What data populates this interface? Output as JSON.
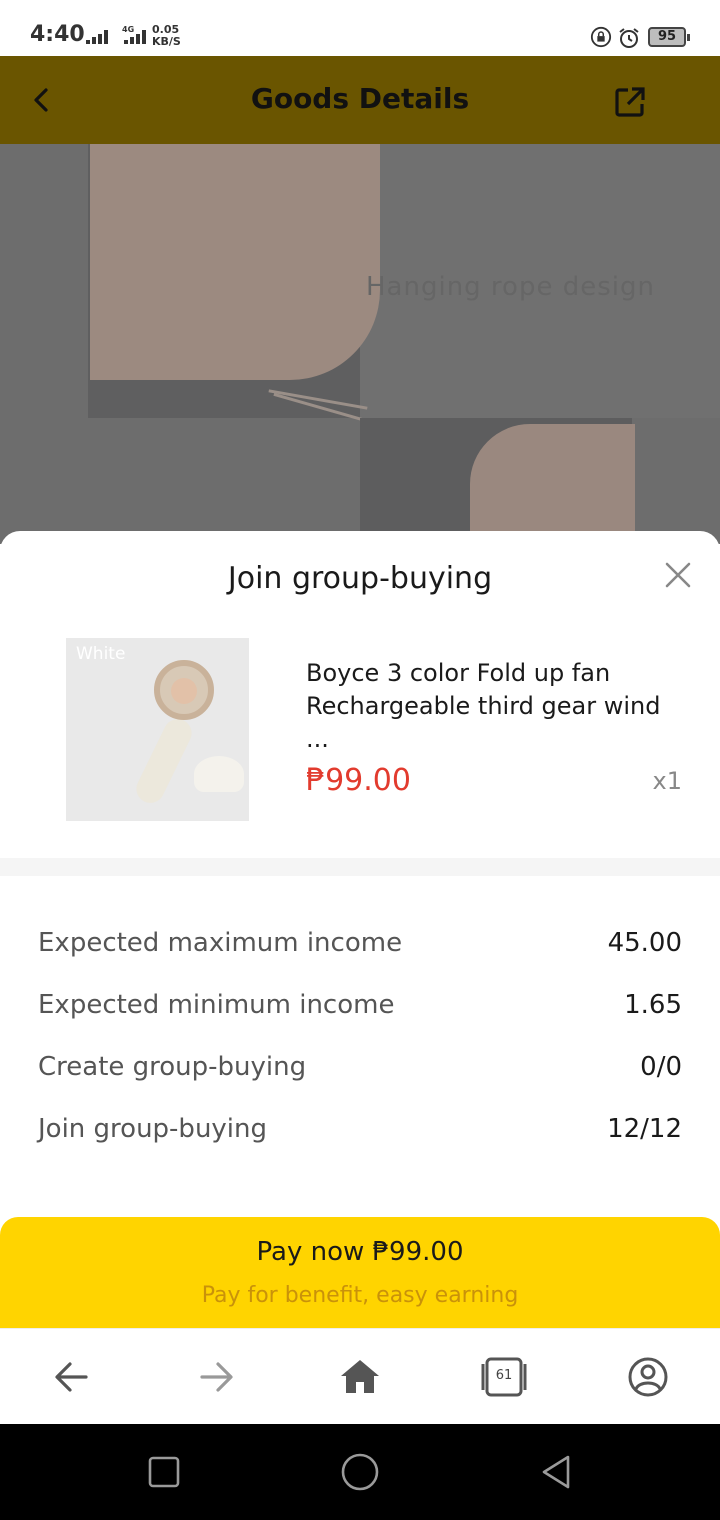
{
  "status_bar": {
    "time": "4:40",
    "network": "4G",
    "speed_value": "0.05",
    "speed_unit": "KB/S",
    "battery": "95"
  },
  "header": {
    "title": "Goods Details",
    "back_icon": "chevron-left-icon",
    "share_icon": "external-link-icon"
  },
  "product_image": {
    "caption": "Hanging rope design"
  },
  "sheet": {
    "title": "Join group-buying",
    "close_icon": "close-icon",
    "product": {
      "variant_label": "White",
      "name": "Boyce 3 color Fold up fan Rechargeable third gear wind ...",
      "price": "₱99.00",
      "quantity": "x1"
    },
    "stats": [
      {
        "label": "Expected maximum income",
        "value": "45.00"
      },
      {
        "label": "Expected minimum income",
        "value": "1.65"
      },
      {
        "label": "Create group-buying",
        "value": "0/0"
      },
      {
        "label": "Join group-buying",
        "value": "12/12"
      }
    ]
  },
  "pay_button": {
    "label": "Pay now ₱99.00",
    "subtitle": "Pay for benefit, easy earning"
  },
  "browser_nav": {
    "tabs_count": "61",
    "items": [
      "back-arrow-icon",
      "forward-arrow-icon",
      "home-icon",
      "tabs-icon",
      "profile-icon"
    ]
  },
  "colors": {
    "header_bg": "#6a5500",
    "accent_yellow": "#ffd400",
    "price_red": "#e23b2e",
    "subtitle_orange": "#c9920a"
  }
}
